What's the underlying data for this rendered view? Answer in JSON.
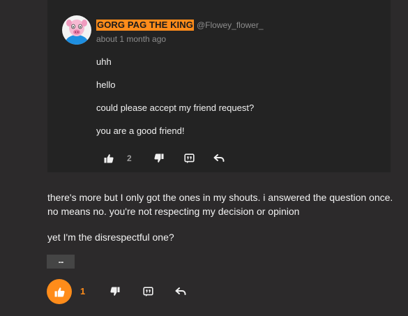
{
  "quoted_post": {
    "username": "GORG PAG THE KING",
    "handle": "@Flowey_flower_",
    "timestamp": "about 1 month ago",
    "lines": [
      "uhh",
      "hello",
      "could please accept my friend request?",
      "you are a good friend!"
    ],
    "like_count": "2",
    "icons": [
      "thumbs-up-icon",
      "thumbs-down-icon",
      "quote-icon",
      "reply-icon"
    ]
  },
  "post": {
    "paragraphs": [
      "there's more but I only got the ones in my shouts. i answered the question once. no means no. you're not respecting my decision or opinion",
      "yet I'm the disrespectful one?"
    ],
    "more_label": "...",
    "like_count": "1",
    "like_active": true,
    "icons": [
      "thumbs-up-icon",
      "thumbs-down-icon",
      "quote-icon",
      "reply-icon"
    ]
  },
  "colors": {
    "background": "#2c2a2b",
    "card": "#232323",
    "accent": "#ff8c1a",
    "text": "#f1f1f1",
    "muted": "#8d8d8d"
  }
}
